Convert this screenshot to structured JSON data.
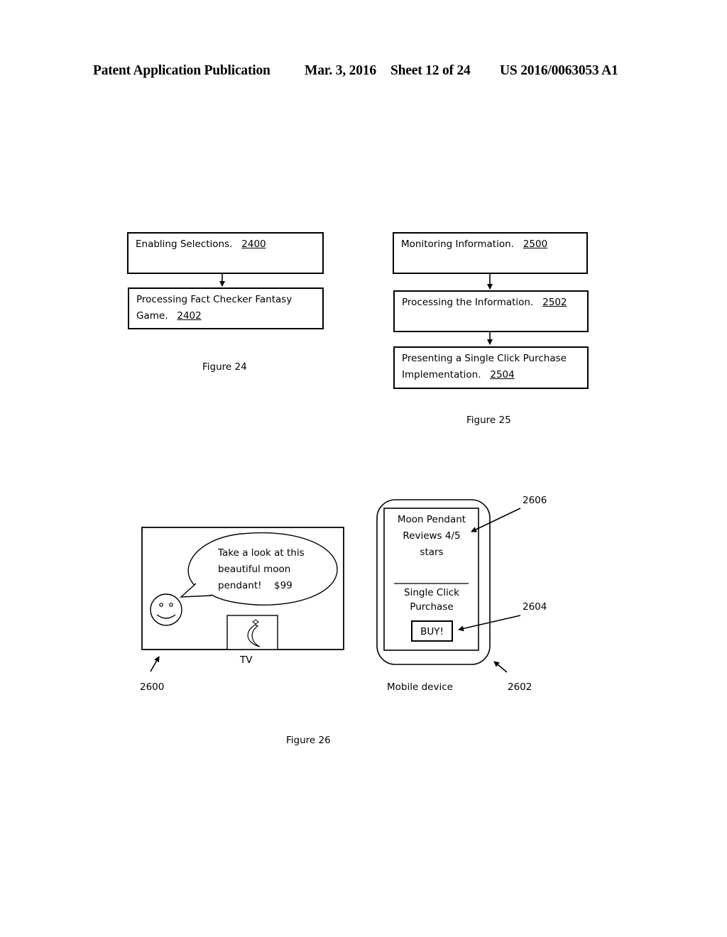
{
  "header": {
    "publication": "Patent Application Publication",
    "date": "Mar. 3, 2016",
    "sheet": "Sheet 12 of 24",
    "number": "US 2016/0063053 A1"
  },
  "figure24": {
    "caption": "Figure 24",
    "steps": [
      {
        "text": "Enabling Selections.",
        "ref": "2400"
      },
      {
        "text": "Processing Fact Checker Fantasy Game.",
        "ref": "2402"
      }
    ]
  },
  "figure25": {
    "caption": "Figure 25",
    "steps": [
      {
        "text": "Monitoring Information.",
        "ref": "2500"
      },
      {
        "text": "Processing the Information.",
        "ref": "2502"
      },
      {
        "text": "Presenting a Single Click Purchase Implementation.",
        "ref": "2504"
      }
    ]
  },
  "figure26": {
    "caption": "Figure 26",
    "tv": {
      "label": "TV",
      "ref": "2600",
      "speech_line1": "Take a look at this",
      "speech_line2": "beautiful moon",
      "speech_line3": "pendant!",
      "price": "$99"
    },
    "mobile": {
      "label": "Mobile device",
      "ref": "2602",
      "product_line1": "Moon Pendant",
      "product_line2": "Reviews 4/5",
      "product_line3": "stars",
      "product_ref": "2606",
      "purchase_line1": "Single Click",
      "purchase_line2": "Purchase",
      "buy_label": "BUY!",
      "buy_ref": "2604"
    }
  }
}
